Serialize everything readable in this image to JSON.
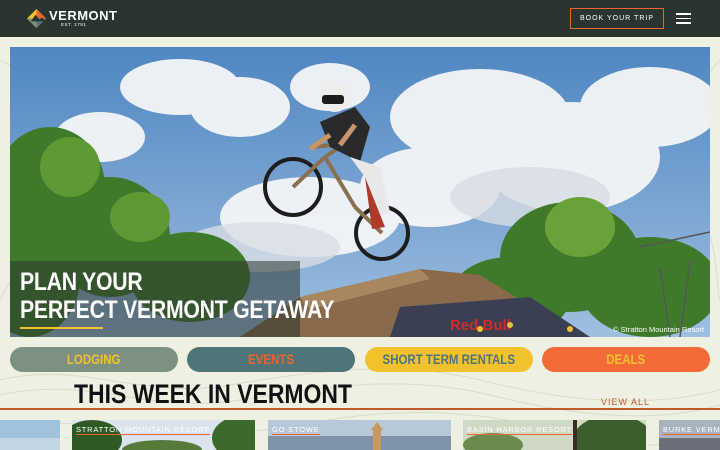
{
  "header": {
    "logo_word": "VERMONT",
    "logo_est": "EST. 1791",
    "book_label": "BOOK YOUR TRIP",
    "menu_icon": "hamburger-menu-icon"
  },
  "hero": {
    "title_line1": "PLAN YOUR",
    "title_line2": "PERFECT VERMONT GETAWAY",
    "credit": "© Stratton Mountain Resort",
    "sign_text": "Red Bull"
  },
  "categories": [
    {
      "label": "LODGING"
    },
    {
      "label": "EVENTS"
    },
    {
      "label": "SHORT TERM RENTALS"
    },
    {
      "label": "DEALS"
    }
  ],
  "section": {
    "title": "THIS WEEK IN VERMONT",
    "view_all": "VIEW ALL"
  },
  "cards": [
    {
      "label": ""
    },
    {
      "label": "STRATTON MOUNTAIN RESORT"
    },
    {
      "label": "GO STOWE"
    },
    {
      "label": "BASIN HARBOR RESORT"
    },
    {
      "label": "BURKE VERMO"
    }
  ],
  "colors": {
    "header_bg": "#2b3530",
    "accent_orange": "#e8652f",
    "accent_yellow": "#f2c12e",
    "sage": "#7d9183",
    "teal": "#4f7579",
    "page_bg": "#eef0e2"
  }
}
